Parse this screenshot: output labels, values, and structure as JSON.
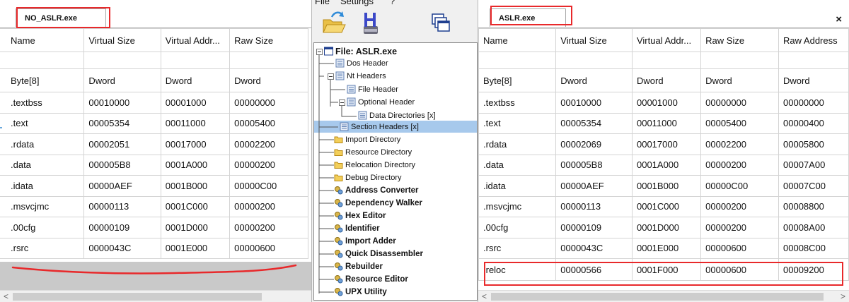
{
  "left_panel": {
    "tab_label": "NO_ASLR.exe",
    "columns": [
      "Name",
      "Virtual Size",
      "Virtual Addr...",
      "Raw Size"
    ],
    "types": [
      "Byte[8]",
      "Dword",
      "Dword",
      "Dword"
    ],
    "rows": [
      [
        ".textbss",
        "00010000",
        "00001000",
        "00000000"
      ],
      [
        ".text",
        "00005354",
        "00011000",
        "00005400"
      ],
      [
        ".rdata",
        "00002051",
        "00017000",
        "00002200"
      ],
      [
        ".data",
        "000005B8",
        "0001A000",
        "00000200"
      ],
      [
        ".idata",
        "00000AEF",
        "0001B000",
        "00000C00"
      ],
      [
        ".msvcjmc",
        "00000113",
        "0001C000",
        "00000200"
      ],
      [
        ".00cfg",
        "00000109",
        "0001D000",
        "00000200"
      ],
      [
        ".rsrc",
        "0000043C",
        "0001E000",
        "00000600"
      ]
    ],
    "scroll_left_arrow": "<"
  },
  "middle_panel": {
    "menu": [
      "File",
      "Settings",
      "?"
    ],
    "toolbar_icons": [
      "open-folder-icon",
      "hex-disk-icon",
      "windows-icon"
    ],
    "tree": {
      "root": "File: ASLR.exe",
      "dos_header": "Dos Header",
      "nt_headers": "Nt Headers",
      "file_header": "File Header",
      "optional_header": "Optional Header",
      "data_directories": "Data Directories [x]",
      "section_headers": "Section Headers [x]",
      "import_directory": "Import Directory",
      "resource_directory": "Resource Directory",
      "relocation_directory": "Relocation Directory",
      "debug_directory": "Debug Directory",
      "tools": [
        "Address Converter",
        "Dependency Walker",
        "Hex Editor",
        "Identifier",
        "Import Adder",
        "Quick Disassembler",
        "Rebuilder",
        "Resource Editor",
        "UPX Utility"
      ]
    },
    "selected_item": "Section Headers [x]"
  },
  "right_panel": {
    "tab_label": "ASLR.exe",
    "close_label": "×",
    "columns": [
      "Name",
      "Virtual Size",
      "Virtual Addr...",
      "Raw Size",
      "Raw Address"
    ],
    "types": [
      "Byte[8]",
      "Dword",
      "Dword",
      "Dword",
      "Dword"
    ],
    "rows": [
      [
        ".textbss",
        "00010000",
        "00001000",
        "00000000",
        "00000000"
      ],
      [
        ".text",
        "00005354",
        "00011000",
        "00005400",
        "00000400"
      ],
      [
        ".rdata",
        "00002069",
        "00017000",
        "00002200",
        "00005800"
      ],
      [
        ".data",
        "000005B8",
        "0001A000",
        "00000200",
        "00007A00"
      ],
      [
        ".idata",
        "00000AEF",
        "0001B000",
        "00000C00",
        "00007C00"
      ],
      [
        ".msvcjmc",
        "00000113",
        "0001C000",
        "00000200",
        "00008800"
      ],
      [
        ".00cfg",
        "00000109",
        "0001D000",
        "00000200",
        "00008A00"
      ],
      [
        ".rsrc",
        "0000043C",
        "0001E000",
        "00000600",
        "00008C00"
      ],
      [
        ".reloc",
        "00000566",
        "0001F000",
        "00000600",
        "00009200"
      ]
    ],
    "scroll_left_arrow": "<",
    "scroll_right_arrow": ">"
  },
  "colors": {
    "annotation_red": "#e8292b",
    "selection_blue": "#a7c9ec",
    "grid_line": "#d4d4d4",
    "empty_area_gray": "#c9c9c9"
  }
}
